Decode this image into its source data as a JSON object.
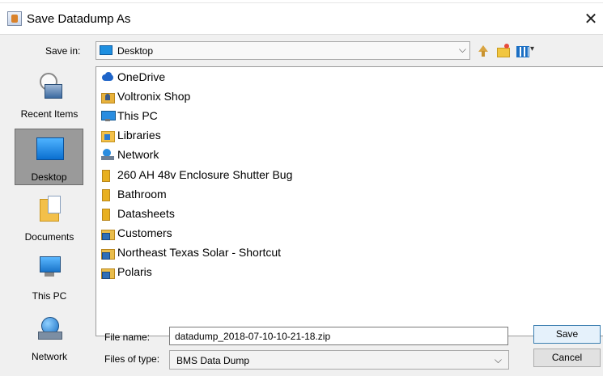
{
  "window": {
    "title": "Save Datadump As",
    "close_glyph": "✕"
  },
  "toolbar": {
    "save_in_label": "Save in:",
    "save_in_value": "Desktop",
    "dropdown_glyph": "⌵"
  },
  "places": [
    {
      "label": "Recent Items",
      "icon": "recent-items-icon"
    },
    {
      "label": "Desktop",
      "icon": "desktop-icon",
      "selected": true
    },
    {
      "label": "Documents",
      "icon": "documents-icon"
    },
    {
      "label": "This PC",
      "icon": "this-pc-icon"
    },
    {
      "label": "Network",
      "icon": "network-icon"
    }
  ],
  "files": [
    {
      "label": "OneDrive",
      "icon": "onedrive-icon"
    },
    {
      "label": "Voltronix Shop",
      "icon": "user-folder-icon"
    },
    {
      "label": "This PC",
      "icon": "computer-icon"
    },
    {
      "label": "Libraries",
      "icon": "libraries-icon"
    },
    {
      "label": "Network",
      "icon": "network-icon"
    },
    {
      "label": "260 AH 48v Enclosure Shutter Bug",
      "icon": "folder-icon"
    },
    {
      "label": "Bathroom",
      "icon": "folder-icon"
    },
    {
      "label": "Datasheets",
      "icon": "folder-icon"
    },
    {
      "label": "Customers",
      "icon": "shortcut-folder-icon"
    },
    {
      "label": "Northeast Texas Solar - Shortcut",
      "icon": "shortcut-folder-icon"
    },
    {
      "label": "Polaris",
      "icon": "shortcut-folder-icon"
    }
  ],
  "form": {
    "file_name_label": "File name:",
    "file_name_value": "datadump_2018-07-10-10-21-18.zip",
    "file_type_label": "Files of type:",
    "file_type_value": "BMS Data Dump"
  },
  "buttons": {
    "save": "Save",
    "cancel": "Cancel"
  },
  "colors": {
    "dialog_bg": "#f0f0f0",
    "selected_place": "#9a9a9a",
    "accent_blue": "#1e8fe0"
  }
}
